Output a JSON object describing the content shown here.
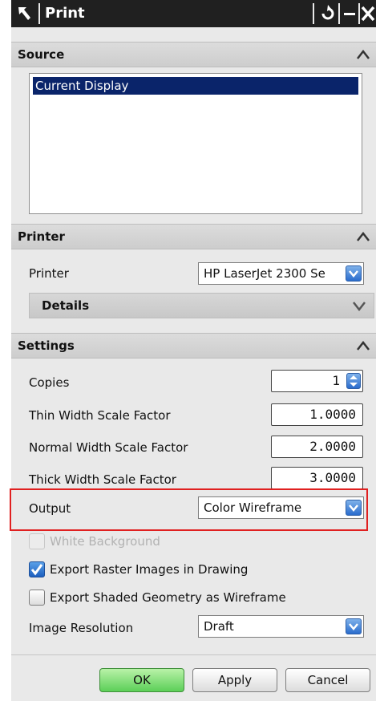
{
  "window": {
    "title": "Print"
  },
  "source": {
    "header": "Source",
    "items": [
      "Current Display"
    ]
  },
  "printer": {
    "header": "Printer",
    "printer_label": "Printer",
    "printer_value": "HP LaserJet 2300 Se",
    "details_label": "Details"
  },
  "settings": {
    "header": "Settings",
    "copies_label": "Copies",
    "copies_value": "1",
    "thin_label": "Thin Width Scale Factor",
    "thin_value": "1.0000",
    "normal_label": "Normal Width Scale Factor",
    "normal_value": "2.0000",
    "thick_label": "Thick Width Scale Factor",
    "thick_value": "3.0000",
    "output_label": "Output",
    "output_value": "Color Wireframe",
    "white_bg_label": "White Background",
    "white_bg_checked": false,
    "raster_label": "Export Raster Images in Drawing",
    "raster_checked": true,
    "shaded_label": "Export Shaded Geometry as Wireframe",
    "shaded_checked": false,
    "resolution_label": "Image Resolution",
    "resolution_value": "Draft"
  },
  "buttons": {
    "ok": "OK",
    "apply": "Apply",
    "cancel": "Cancel"
  },
  "colors": {
    "selection": "#0a246a",
    "highlight_border": "#e02020",
    "ok_green": "#5ccf58",
    "dropdown_blue": "#2a6ccd"
  }
}
